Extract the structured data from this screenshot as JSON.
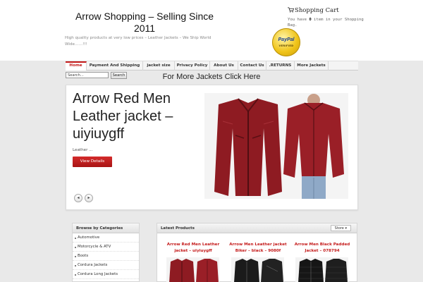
{
  "header": {
    "site_title": "Arrow Shopping – Selling Since 2011",
    "tagline": "High quality products at very low prices – Leather Jackets – We Ship World Wide……!!!",
    "cart_title": "Shopping Cart",
    "cart_text_before": "You have ",
    "cart_count": "0",
    "cart_text_after": " item in your Shopping Bag.",
    "paypal_word": "PayPal",
    "paypal_sub": "VERIFIED"
  },
  "nav": {
    "items": [
      {
        "label": "Home"
      },
      {
        "label": "Payment And Shipping"
      },
      {
        "label": "jacket size"
      },
      {
        "label": "Privacy Policy"
      },
      {
        "label": "About Us"
      },
      {
        "label": "Contact Us"
      },
      {
        "label": ".RETURNS"
      },
      {
        "label": "More Jackets"
      }
    ]
  },
  "search": {
    "value": "Search...",
    "button_label": "Search"
  },
  "more_link": "For More Jackets Click Here",
  "slider": {
    "title": "Arrow Red Men Leather jacket – uiyiuygff",
    "excerpt": "Leather ...",
    "button_label": "View Details",
    "prev_icon": "◂",
    "next_icon": "▸"
  },
  "sidebar": {
    "heading": "Browse by Categories",
    "categories": [
      {
        "label": "Automotive"
      },
      {
        "label": "Motorcycle & ATV"
      },
      {
        "label": "Boots"
      },
      {
        "label": "Cordura Jackets"
      },
      {
        "label": "Cordura Long Jackets"
      }
    ]
  },
  "latest": {
    "heading": "Latest Products",
    "store_label": "Store ▾",
    "products": [
      {
        "title": "Arrow Red Men Leather jacket – uiyiuygff"
      },
      {
        "title": "Arrow Men Leather jacket Biker – black – 9080f"
      },
      {
        "title": "Arrow Men Black Padded Jacket – 078794"
      }
    ]
  },
  "colors": {
    "accent": "#c41a1a",
    "background": "#e9e9e9",
    "paypal_gold": "#f0c419",
    "jacket_red": "#8e1b22"
  }
}
